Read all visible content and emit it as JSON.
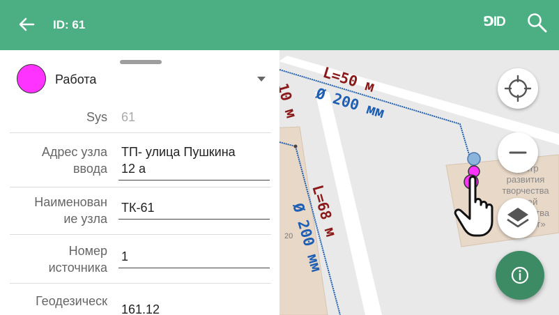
{
  "header": {
    "title": "ID: 61",
    "pid_label": "⅁ID"
  },
  "panel": {
    "status": {
      "label": "Работа",
      "color": "#ff33ff"
    },
    "fields": [
      {
        "label_lines": [
          "Sys"
        ],
        "value": "61",
        "editable": false
      },
      {
        "label_lines": [
          "Адрес узла",
          "ввода"
        ],
        "value_lines": [
          "ТП- улица Пушкина",
          "12 а"
        ],
        "editable": true
      },
      {
        "label_lines": [
          "Наименован",
          "ие узла"
        ],
        "value": "ТК-61",
        "editable": true
      },
      {
        "label_lines": [
          "Номер",
          "источника"
        ],
        "value": "1",
        "editable": true
      },
      {
        "label_lines": [
          "Геодезическ"
        ],
        "value": "161.12",
        "editable": true
      }
    ]
  },
  "map": {
    "labels": {
      "pipe_top_length": "L=50 м",
      "pipe_top_diameter": "Ø 200 мм",
      "pipe_vert_length": "L=68 м",
      "pipe_vert_diameter": "Ø 200 мм",
      "building_label_lines": [
        "Центр",
        "развития",
        "творчества",
        "детей",
        "юношества",
        "«Диалог»"
      ],
      "house_number": "20",
      "edge_label": "10 м"
    },
    "colors": {
      "pipe": "#1e5fb4",
      "label_red": "#8b1a1a",
      "label_blue": "#1e5fb4",
      "road": "#ffffff",
      "building": "#e8d8c8"
    }
  },
  "controls": {
    "locate_icon": "crosshair-icon",
    "zoom_out_icon": "minus-icon",
    "layers_icon": "layers-icon",
    "info_icon": "info-icon"
  },
  "theme": {
    "primary": "#4caf84",
    "fab": "#3d8b65"
  }
}
